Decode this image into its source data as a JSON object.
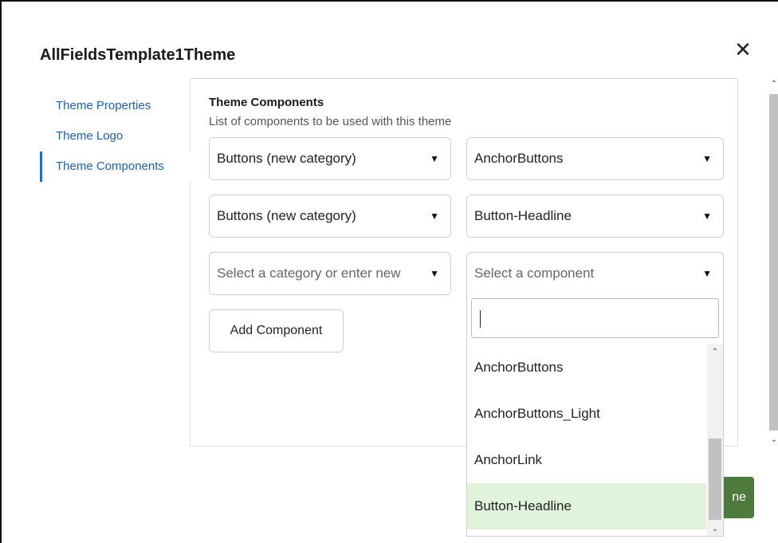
{
  "dialog": {
    "title": "AllFieldsTemplate1Theme"
  },
  "tabs": [
    {
      "label": "Theme Properties"
    },
    {
      "label": "Theme Logo"
    },
    {
      "label": "Theme Components"
    }
  ],
  "section": {
    "title": "Theme Components",
    "subtitle": "List of components to be used with this theme"
  },
  "rows": [
    {
      "category": "Buttons (new category)",
      "component": "AnchorButtons"
    },
    {
      "category": "Buttons (new category)",
      "component": "Button-Headline"
    },
    {
      "category_placeholder": "Select a category or enter new",
      "component_placeholder": "Select a component"
    }
  ],
  "add_button": {
    "label": "Add Component"
  },
  "dropdown": {
    "search_value": "",
    "items": [
      "AnchorButtons",
      "AnchorButtons_Light",
      "AnchorLink",
      "Button-Headline"
    ],
    "selected": "Button-Headline"
  },
  "done_button": {
    "label_visible": "ne"
  },
  "colors": {
    "accent": "#1f6fc5",
    "selected_bg": "#e2f3dc",
    "primary_btn": "#4e7a3e"
  }
}
